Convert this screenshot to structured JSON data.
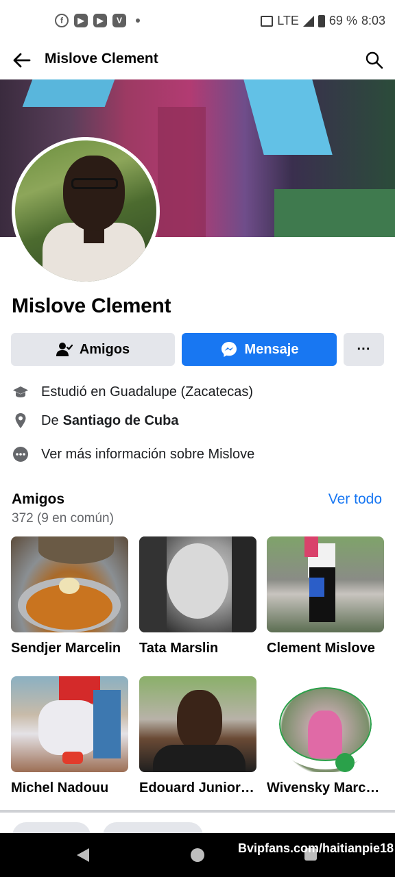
{
  "status_bar": {
    "app_icons": [
      "facebook-icon",
      "youtube-icon",
      "youtube-icon",
      "vpn-icon"
    ],
    "network": "LTE",
    "battery": "69 %",
    "time": "8:03"
  },
  "header": {
    "title": "Mislove Clement"
  },
  "profile": {
    "name": "Mislove Clement"
  },
  "actions": {
    "friends_label": "Amigos",
    "message_label": "Mensaje",
    "more_label": "···"
  },
  "info": {
    "studied": "Estudió en Guadalupe (Zacatecas)",
    "from_prefix": "De",
    "from_place": "Santiago de Cuba",
    "more_info": "Ver más información sobre Mislove"
  },
  "friends": {
    "title": "Amigos",
    "count": "372 (9 en común)",
    "see_all": "Ver todo",
    "items": [
      {
        "name": "Sendjer Marcelin"
      },
      {
        "name": "Tata Marslin"
      },
      {
        "name": "Clement Mislove"
      },
      {
        "name": "Michel Nadouu"
      },
      {
        "name": "Edouard Junior…"
      },
      {
        "name": "Wivensky Marc…"
      }
    ]
  },
  "watermark": "Bvipfans.com/haitianpie18",
  "colors": {
    "primary": "#1877f2",
    "button_gray": "#e4e6eb",
    "secondary_text": "#65676b"
  }
}
